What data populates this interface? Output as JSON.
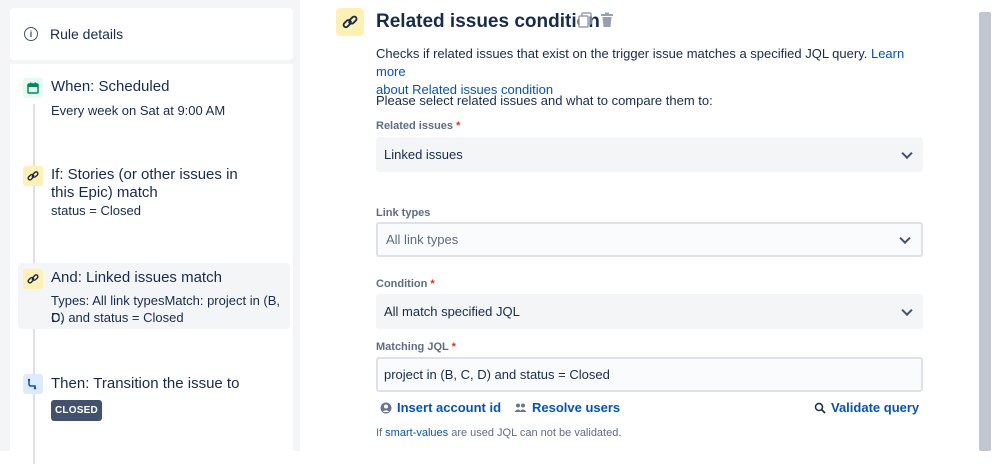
{
  "sidebar": {
    "rule_details": "Rule details",
    "steps": [
      {
        "title": "When: Scheduled",
        "sub": "Every week on Sat at 9:00 AM",
        "icon": "calendar-icon"
      },
      {
        "title1": "If: Stories (or other issues in",
        "title2": "this Epic) match",
        "sub": "status = Closed",
        "icon": "link-icon"
      },
      {
        "title": "And: Linked issues match",
        "sub1": "Types: All link typesMatch: project in (B, C,",
        "sub2": "D) and status = Closed",
        "icon": "link-icon"
      },
      {
        "title": "Then: Transition the issue to",
        "badge": "CLOSED",
        "icon": "transition-icon"
      }
    ]
  },
  "main": {
    "title": "Related issues condition",
    "desc_text": "Checks if related issues that exist on the trigger issue matches a specified JQL query. ",
    "desc_link1": "Learn more",
    "desc_link2": "about Related issues condition",
    "prompt": "Please select related issues and what to compare them to:",
    "related_label": "Related issues",
    "related_value": "Linked issues",
    "link_types_label": "Link types",
    "link_types_placeholder": "All link types",
    "condition_label": "Condition",
    "condition_value": "All match specified JQL",
    "jql_label": "Matching JQL",
    "jql_value": "project in (B, C, D) and status = Closed",
    "insert_account": "Insert account id",
    "resolve_users": "Resolve users",
    "validate_query": "Validate query",
    "note_prefix": "If ",
    "note_link": "smart-values",
    "note_suffix": " are used JQL can not be validated.",
    "required_mark": "*"
  },
  "colors": {
    "link": "#0052cc",
    "text": "#172b4d",
    "required": "#de350b",
    "link_icon_bg": "#fff0b3",
    "calendar_icon_bg": "#e3fcef",
    "transition_icon_bg": "#deebff"
  }
}
